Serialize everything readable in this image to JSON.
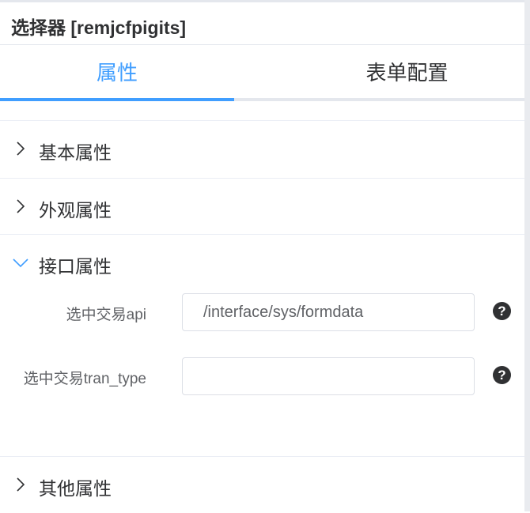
{
  "header": {
    "title": "选择器 [remjcfpigits]"
  },
  "tabs": [
    {
      "label": "属性",
      "active": true
    },
    {
      "label": "表单配置",
      "active": false
    }
  ],
  "sections": {
    "basic": {
      "label": "基本属性",
      "expanded": false
    },
    "appearance": {
      "label": "外观属性",
      "expanded": false
    },
    "interface": {
      "label": "接口属性",
      "expanded": true,
      "fields": [
        {
          "label": "选中交易api",
          "value": "/interface/sys/formdata",
          "help_icon": "?"
        },
        {
          "label": "选中交易tran_type",
          "value": "",
          "help_icon": "?"
        }
      ]
    },
    "other": {
      "label": "其他属性",
      "expanded": false
    }
  },
  "colors": {
    "accent": "#409eff",
    "text": "#303133",
    "border": "#dcdfe6"
  }
}
